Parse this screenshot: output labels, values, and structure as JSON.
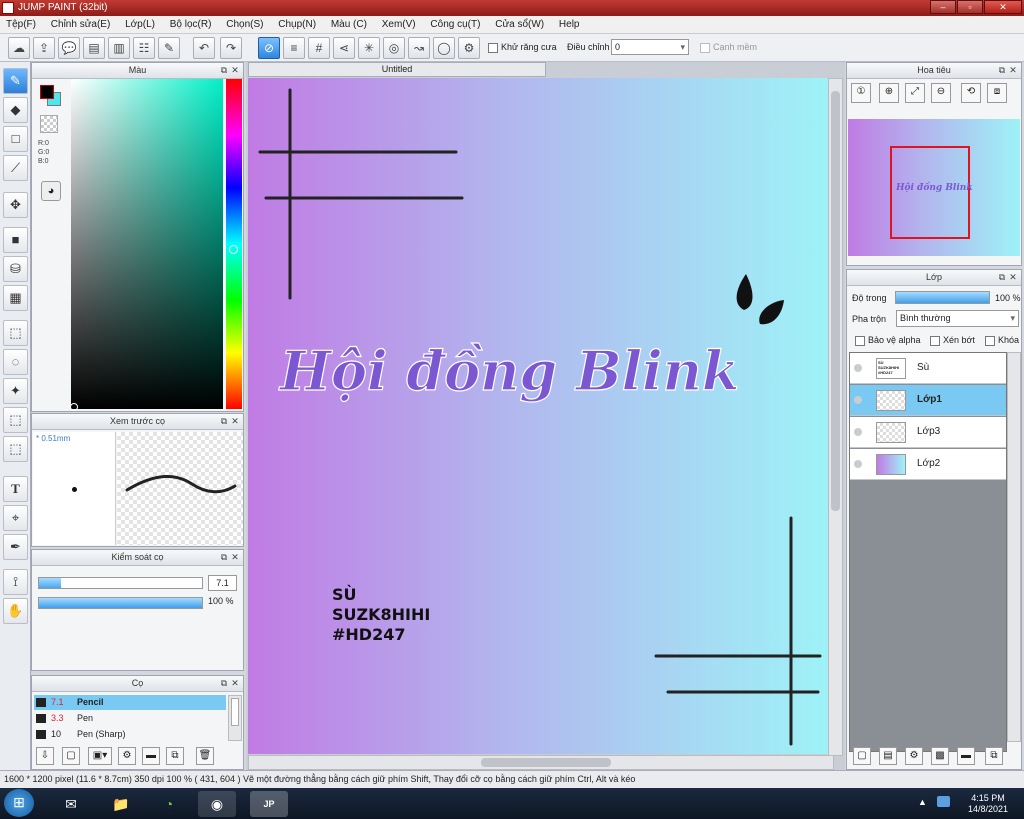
{
  "window": {
    "title": "JUMP PAINT (32bit)"
  },
  "menu": [
    "Tệp(F)",
    "Chỉnh sửa(E)",
    "Lớp(L)",
    "Bộ lọc(R)",
    "Chọn(S)",
    "Chụp(N)",
    "Màu (C)",
    "Xem(V)",
    "Công cụ(T)",
    "Cửa sổ(W)",
    "Help"
  ],
  "toolbar": {
    "antialias_label": "Khử răng cưa",
    "adjust_label": "Điều chỉnh",
    "adjust_value": "0",
    "edge_label": "Cạnh mềm"
  },
  "color_panel": {
    "title": "Màu",
    "r": "R:0",
    "g": "G:0",
    "b": "B:0",
    "fg": "#000000",
    "bg": "#4fe6f0"
  },
  "brush_preview": {
    "title": "Xem trước cọ",
    "size": "* 0.51mm"
  },
  "brush_control": {
    "title": "Kiểm soát cọ",
    "size_value": "7.1",
    "opacity_value": "100 %"
  },
  "brushes": {
    "title": "Cọ",
    "items": [
      {
        "size": "7.1",
        "name": "Pencil"
      },
      {
        "size": "3.3",
        "name": "Pen"
      },
      {
        "size": "10",
        "name": "Pen (Sharp)"
      }
    ]
  },
  "document": {
    "tab": "Untitled",
    "title_text": "Hội đồng Blink",
    "line1": "SÙ",
    "line2": "SUZK8HIHI",
    "line3": "#HD247"
  },
  "navigator": {
    "title": "Hoa tiêu",
    "preview_text": "Hội đồng Blink"
  },
  "layers": {
    "title": "Lớp",
    "opacity_label": "Độ trong",
    "opacity_value": "100 %",
    "blend_label": "Pha trộn",
    "blend_value": "Bình thường",
    "protect_alpha": "Bảo vệ alpha",
    "clip": "Xén bớt",
    "lock": "Khóa",
    "items": [
      {
        "name": "Sù"
      },
      {
        "name": "Lớp1"
      },
      {
        "name": "Lớp3"
      },
      {
        "name": "Lớp2"
      }
    ],
    "thumb_text": "SÙ SUZK8HIHI #HD247"
  },
  "status": {
    "text": "1600 * 1200 pixel   (11.6 * 8.7cm)   350 dpi   100 %   ( 431, 604 )   Vẽ một đường thẳng bằng cách giữ phím Shift, Thay đổi cỡ cọ bằng cách giữ phím Ctrl, Alt và kéo"
  },
  "clock": {
    "time": "4:15 PM",
    "date": "14/8/2021"
  },
  "colors": {
    "accent": "#2f86dd",
    "title_bar": "#b3302a",
    "selection": "#79c9f2"
  }
}
